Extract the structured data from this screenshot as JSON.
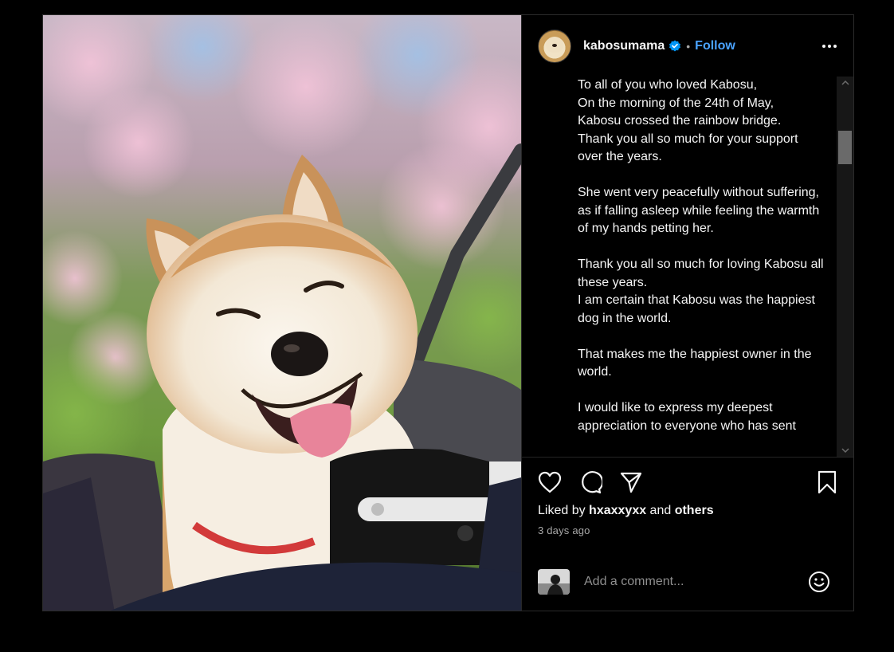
{
  "post": {
    "username": "kabosumama",
    "separator": "•",
    "follow_label": "Follow",
    "verified": true,
    "accent_color": "#4aa3ff",
    "caption_paragraphs": [
      "To all of you who loved Kabosu,\nOn the morning of the 24th of May,\nKabosu crossed the rainbow bridge.\nThank you all so much for your support over the years.",
      "She went very peacefully without suffering, as if falling asleep while feeling the warmth of my hands petting her.",
      "Thank you all so much for loving Kabosu all these years.\nI am certain that Kabosu was the happiest dog in the world.",
      "That makes me the happiest owner in the world.",
      "I would like to express my deepest appreciation to everyone who has sent"
    ],
    "likes": {
      "prefix": "Liked by ",
      "user": "hxaxxyxx",
      "middle": " and ",
      "others": "others"
    },
    "timestamp": "3 days ago",
    "comment_placeholder": "Add a comment..."
  },
  "icons": {
    "more": "more-options-icon",
    "like": "heart-icon",
    "comment": "comment-bubble-icon",
    "share": "send-icon",
    "save": "bookmark-icon",
    "emoji": "emoji-smiley-icon",
    "verified": "verified-badge-icon"
  },
  "colors": {
    "background": "#000000",
    "text": "#f5f5f5",
    "secondary_text": "#a8a8a8",
    "link": "#4aa3ff",
    "verified_badge": "#0095f6"
  }
}
